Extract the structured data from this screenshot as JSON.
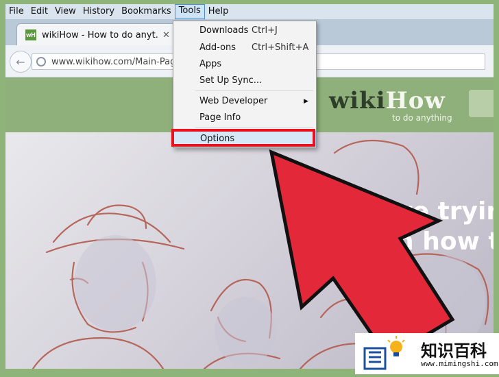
{
  "menubar": {
    "items": [
      "File",
      "Edit",
      "View",
      "History",
      "Bookmarks",
      "Tools",
      "Help"
    ],
    "active": "Tools"
  },
  "tab": {
    "title": "wikiHow - How to do anyt...",
    "favicon_text": "wH",
    "close": "✕"
  },
  "urlbar": {
    "url": "www.wikihow.com/Main-Page"
  },
  "tools_menu": {
    "items": [
      {
        "label": "Downloads",
        "shortcut": "Ctrl+J"
      },
      {
        "label": "Add-ons",
        "shortcut": "Ctrl+Shift+A"
      },
      {
        "label": "Apps",
        "shortcut": ""
      },
      {
        "label": "Set Up Sync...",
        "shortcut": ""
      },
      {
        "label": "Web Developer",
        "shortcut": "",
        "submenu": "▶"
      },
      {
        "label": "Page Info",
        "shortcut": ""
      },
      {
        "label": "Options",
        "shortcut": ""
      }
    ],
    "highlighted": "Options"
  },
  "site": {
    "logo_wiki": "wiki",
    "logo_how": "How",
    "tagline": "to do anything",
    "hero_line1": "We're trying",
    "hero_line2": "arn how t"
  },
  "watermark": {
    "chinese": "知识百科",
    "url": "www.mimingshi.com"
  },
  "colors": {
    "highlight_box": "#e8121e",
    "arrow_red": "#e3283a",
    "site_green": "#8fb07a"
  },
  "icons": [
    "back-arrow-icon",
    "globe-icon",
    "submenu-arrow-icon",
    "red-arrow-icon",
    "book-lightbulb-icon"
  ]
}
